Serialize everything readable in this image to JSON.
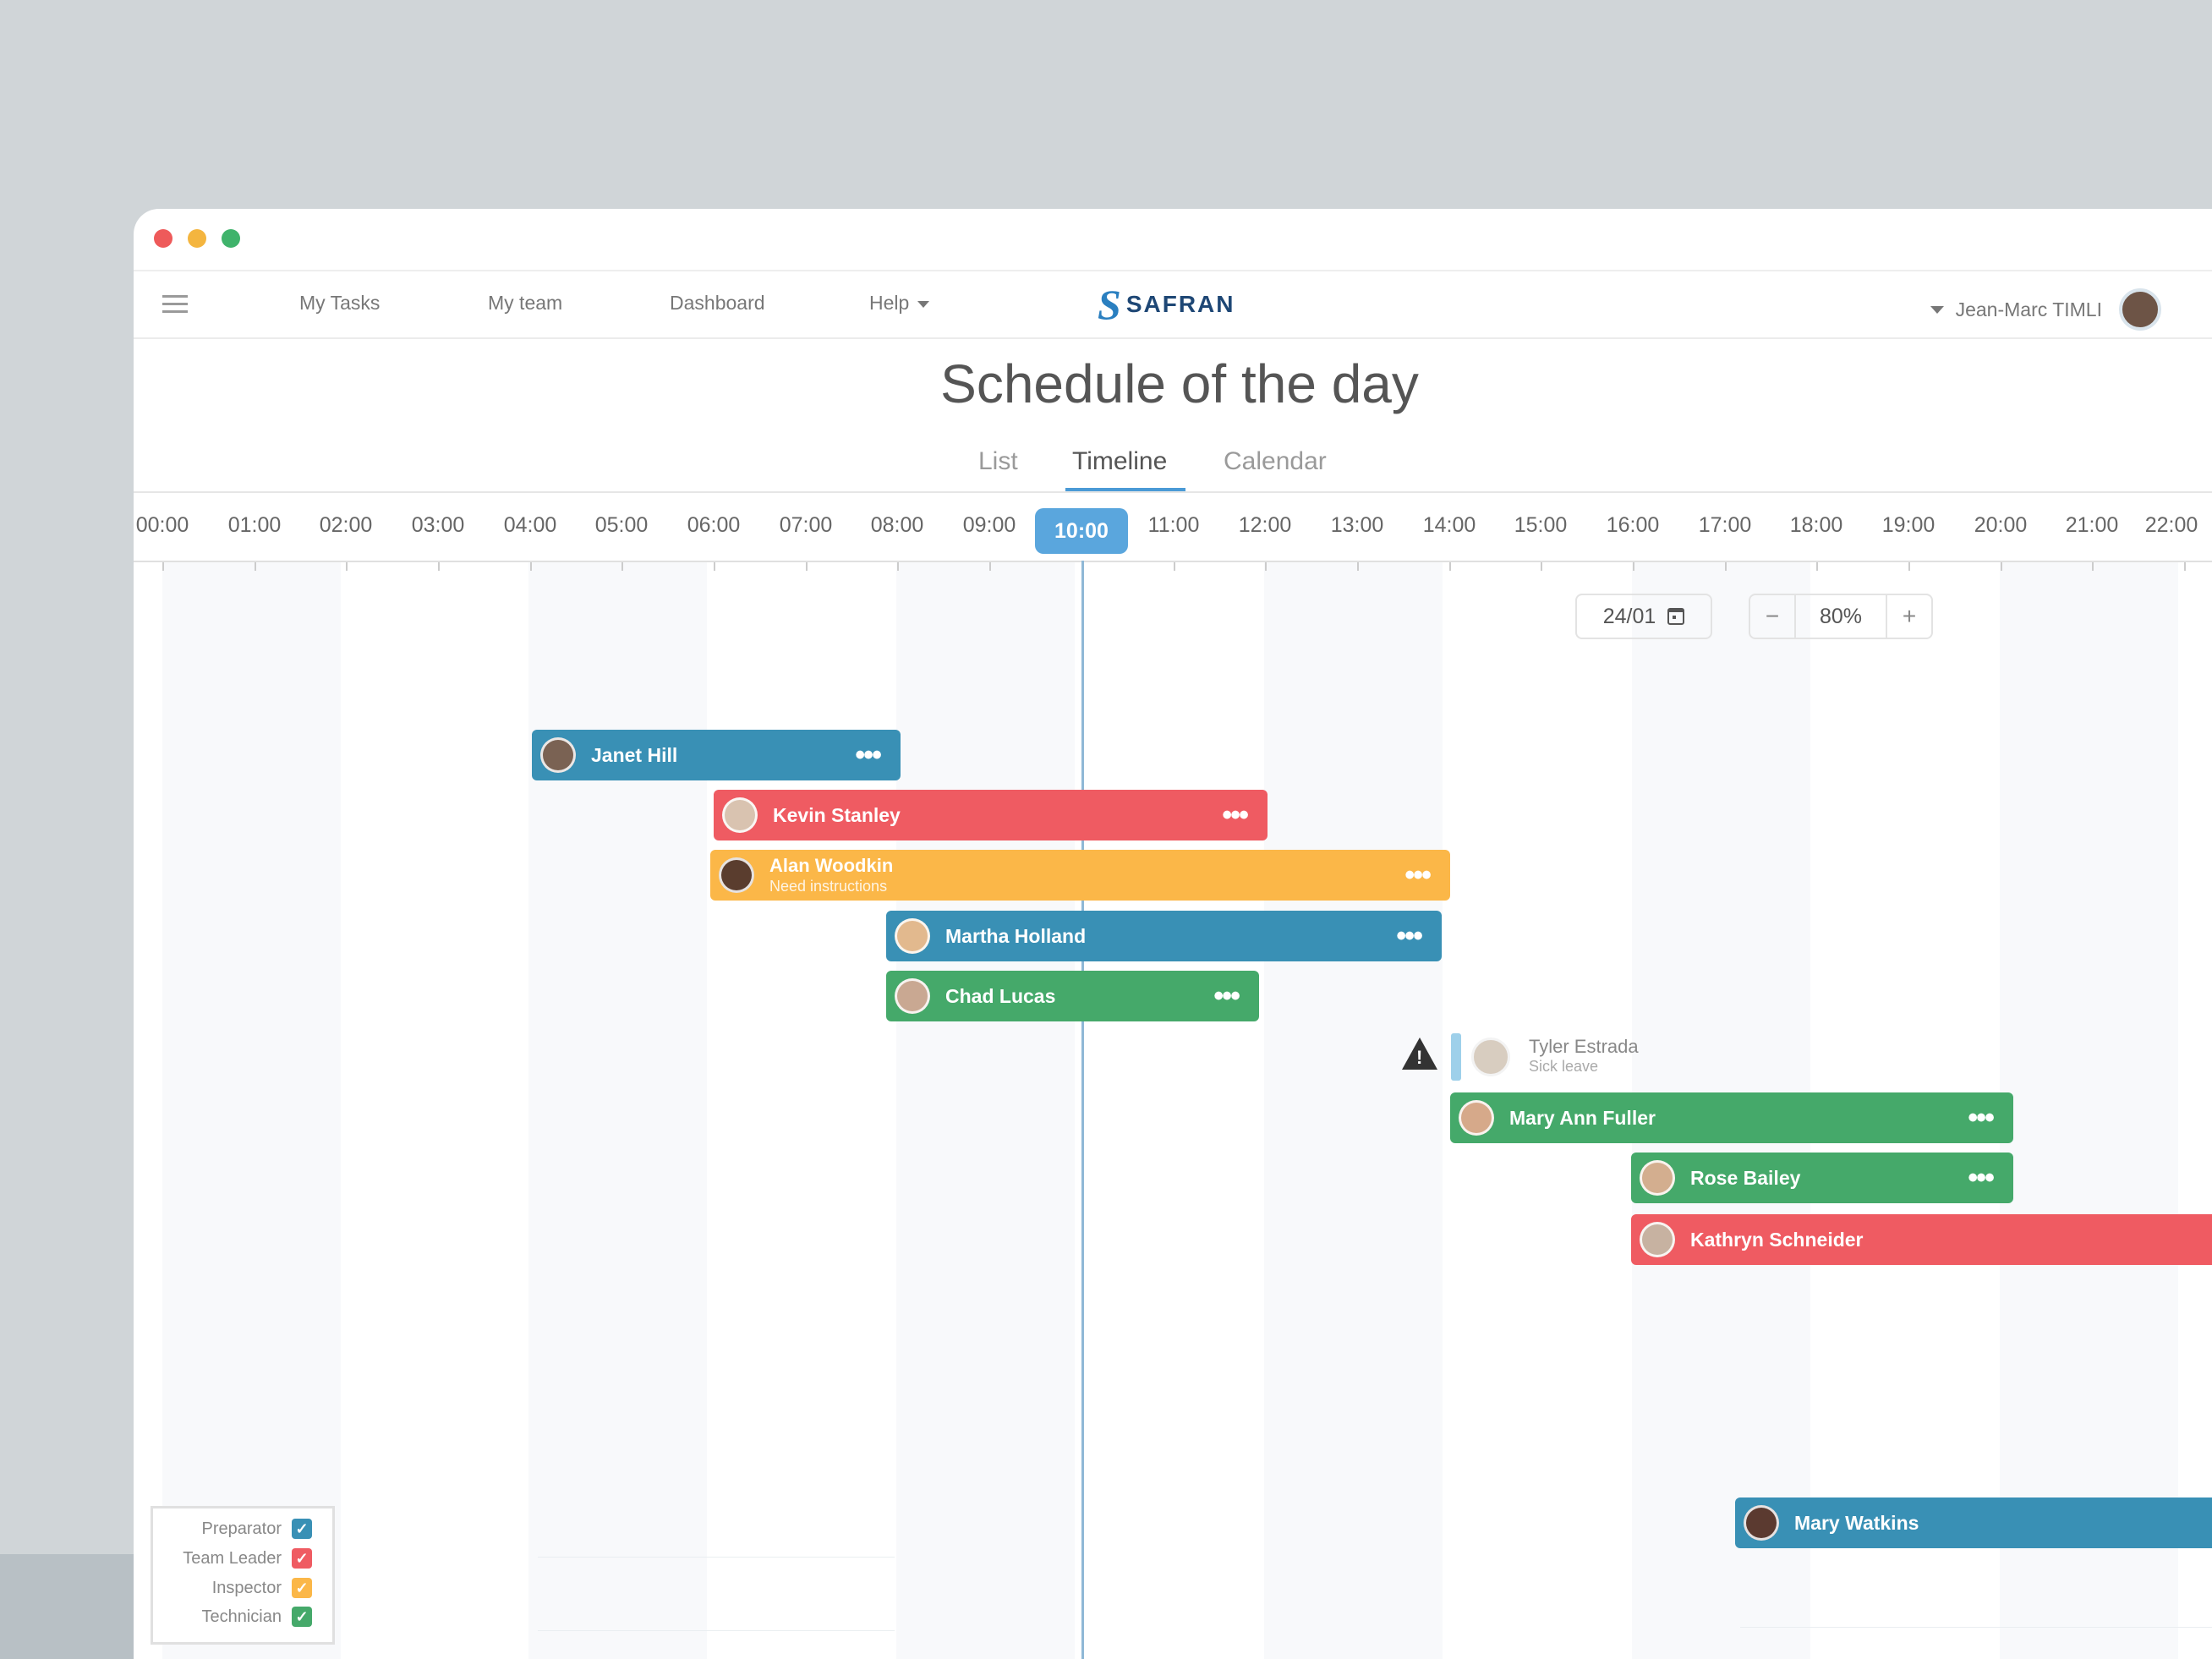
{
  "nav": {
    "links": [
      "My Tasks",
      "My team",
      "Dashboard"
    ],
    "help_label": "Help",
    "logo_text": "SAFRAN",
    "user_name": "Jean-Marc TIMLI"
  },
  "page_title": "Schedule of the day",
  "tabs": [
    "List",
    "Timeline",
    "Calendar"
  ],
  "active_tab": "Timeline",
  "hours": [
    "00:00",
    "01:00",
    "02:00",
    "03:00",
    "04:00",
    "05:00",
    "06:00",
    "07:00",
    "08:00",
    "09:00",
    "10:00",
    "11:00",
    "12:00",
    "13:00",
    "14:00",
    "15:00",
    "16:00",
    "17:00",
    "18:00",
    "19:00",
    "20:00",
    "21:00",
    "22:00"
  ],
  "current_hour": "10:00",
  "date_value": "24/01",
  "zoom": {
    "minus": "−",
    "value": "80%",
    "plus": "+"
  },
  "more_label": "•••",
  "warning_symbol": "!",
  "tasks": [
    {
      "name": "Janet Hill",
      "role": "Preparator"
    },
    {
      "name": "Kevin Stanley",
      "role": "Team Leader"
    },
    {
      "name": "Alan Woodkin",
      "subtitle": "Need instructions",
      "role": "Inspector"
    },
    {
      "name": "Martha Holland",
      "role": "Preparator"
    },
    {
      "name": "Chad Lucas",
      "role": "Technician"
    },
    {
      "name": "Mary Ann Fuller",
      "role": "Technician"
    },
    {
      "name": "Rose Bailey",
      "role": "Technician"
    },
    {
      "name": "Kathryn Schneider",
      "role": "Team Leader"
    },
    {
      "name": "Mary Watkins",
      "role": "Preparator"
    }
  ],
  "leave": {
    "name": "Tyler Estrada",
    "status": "Sick leave"
  },
  "legend": {
    "items": [
      {
        "label": "Preparator",
        "color": "#3990b5"
      },
      {
        "label": "Team Leader",
        "color": "#ef5b62"
      },
      {
        "label": "Inspector",
        "color": "#fbb748"
      },
      {
        "label": "Technician",
        "color": "#45a96a"
      }
    ],
    "check_symbol": "✓"
  },
  "colors": {
    "preparator": "#3990b5",
    "team_leader": "#ef5b62",
    "inspector": "#fbb748",
    "technician": "#45a96a",
    "accent": "#5aa6dd"
  }
}
